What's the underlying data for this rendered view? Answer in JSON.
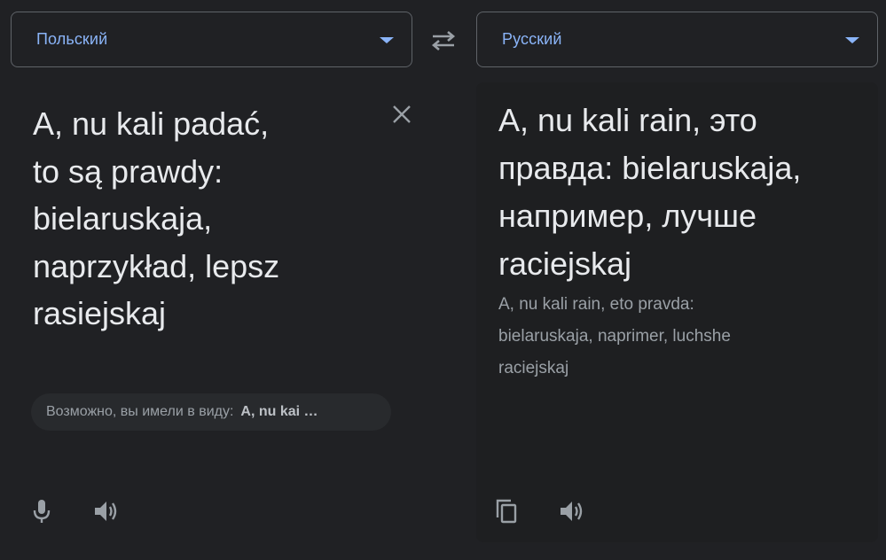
{
  "source_lang": {
    "label": "Польский"
  },
  "target_lang": {
    "label": "Русский"
  },
  "source": {
    "text": "A, nu kali padać,\nto są prawdy:\nbielaruskaja,\nnaprzykład, lepsz\nrasiejskaj"
  },
  "suggestion": {
    "prefix": "Возможно, вы имели в виду:",
    "value": "A, nu kai …"
  },
  "target": {
    "text": "A, nu kali rain, это правда: bielaruskaja, например, лучше raciejskaj",
    "transliteration": "A, nu kali rain, eto pravda: bielaruskaja, naprimer, luchshe raciejskaj"
  },
  "icons": {
    "swap": "swap-arrows-icon",
    "clear": "close-icon",
    "mic": "microphone-icon",
    "speaker": "speaker-icon",
    "copy": "copy-icon"
  },
  "colors": {
    "background": "#202124",
    "accent": "#8ab4f8",
    "text": "#e8eaed",
    "muted": "#9aa0a6"
  }
}
